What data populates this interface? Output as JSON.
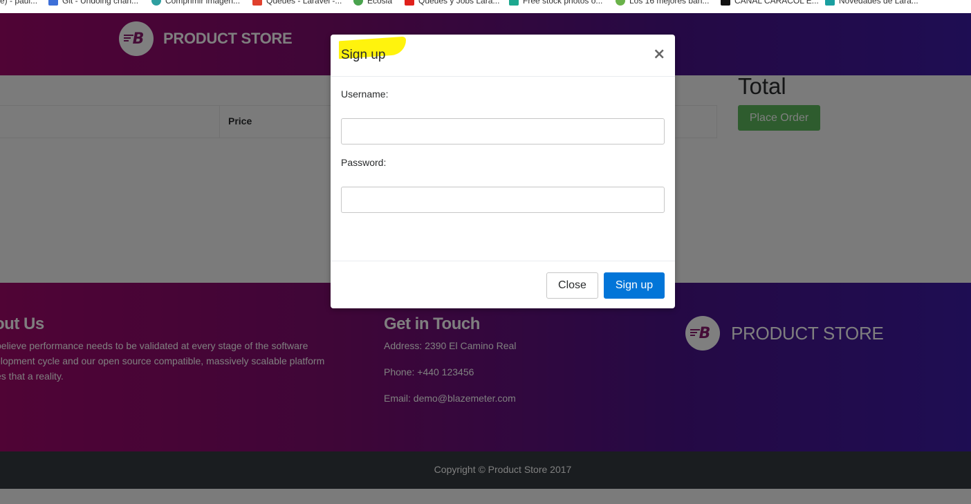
{
  "bookmarks": [
    {
      "label": "e) - paul...",
      "icon": "tab-icon",
      "color": "#8a8a8a"
    },
    {
      "label": "Git - Undoing chan...",
      "icon": "git-icon",
      "color": "#3d6fd8"
    },
    {
      "label": "Comprimir imagen...",
      "icon": "compress-icon",
      "color": "#2f9fa0"
    },
    {
      "label": "Queues - Laravel -...",
      "icon": "laravel-icon",
      "color": "#e0402d"
    },
    {
      "label": "Ecosia",
      "icon": "ecosia-icon",
      "color": "#4aa34e"
    },
    {
      "label": "Queues y Jobs Lara...",
      "icon": "youtube-icon",
      "color": "#e0201b"
    },
    {
      "label": "Free stock photos o...",
      "icon": "pexels-icon",
      "color": "#1da88f"
    },
    {
      "label": "Los 16 mejores ban...",
      "icon": "chat-icon",
      "color": "#6ab24a"
    },
    {
      "label": "CANAL CARACOL E...",
      "icon": "tv-icon",
      "color": "#111111"
    },
    {
      "label": "Novedades de Lara...",
      "icon": "bookmark-icon",
      "color": "#1a9fa0"
    }
  ],
  "navbar": {
    "brand": "PRODUCT STORE",
    "logo_letter": "B"
  },
  "cart": {
    "price_header": "Price",
    "total_label": "Total",
    "place_order": "Place Order"
  },
  "footer": {
    "about_title": "out Us",
    "about_lines": [
      "believe performance needs to be validated at every stage of the software",
      "elopment cycle and our open source compatible, massively scalable platform",
      "es that a reality."
    ],
    "contact_title": "Get in Touch",
    "address": "Address: 2390 El Camino Real",
    "phone": "Phone: +440 123456",
    "email": "Email: demo@blazemeter.com",
    "brand": "PRODUCT STORE",
    "copyright": "Copyright © Product Store 2017"
  },
  "modal": {
    "title": "Sign up",
    "close_symbol": "×",
    "username_label": "Username:",
    "username_value": "",
    "password_label": "Password:",
    "password_value": "",
    "close_button": "Close",
    "signup_button": "Sign up"
  },
  "colors": {
    "gradient_start": "#a0086b",
    "gradient_end": "#3d1ba6",
    "place_order": "#5cb85c",
    "primary": "#0275d8",
    "highlight": "#fff200"
  }
}
